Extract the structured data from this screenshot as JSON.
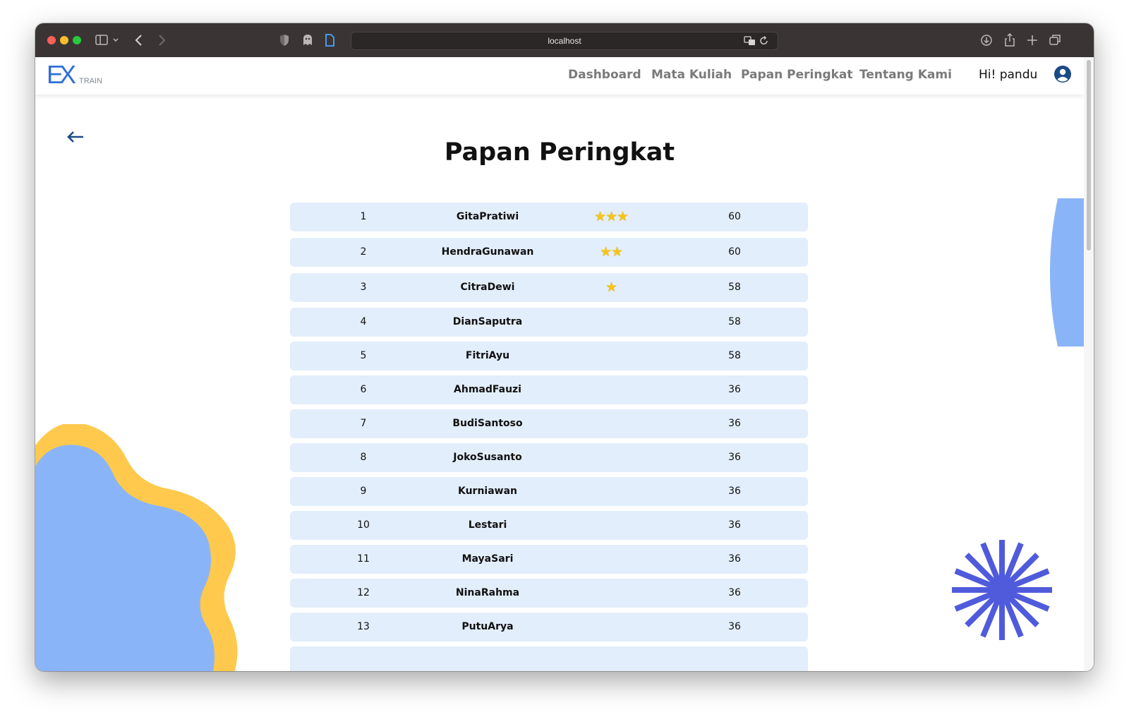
{
  "browser": {
    "url": "localhost"
  },
  "navbar": {
    "logo_main": "EX",
    "logo_sub": "TRAIN",
    "links": [
      {
        "label": "Dashboard"
      },
      {
        "label": "Mata Kuliah"
      },
      {
        "label": "Papan Peringkat"
      },
      {
        "label": "Tentang Kami"
      }
    ],
    "greeting": "Hi! pandu"
  },
  "page": {
    "title": "Papan Peringkat"
  },
  "leaderboard": [
    {
      "rank": "1",
      "name": "GitaPratiwi",
      "stars": "★★★",
      "score": "60"
    },
    {
      "rank": "2",
      "name": "HendraGunawan",
      "stars": "★★",
      "score": "60"
    },
    {
      "rank": "3",
      "name": "CitraDewi",
      "stars": "★",
      "score": "58"
    },
    {
      "rank": "4",
      "name": "DianSaputra",
      "stars": "",
      "score": "58"
    },
    {
      "rank": "5",
      "name": "FitriAyu",
      "stars": "",
      "score": "58"
    },
    {
      "rank": "6",
      "name": "AhmadFauzi",
      "stars": "",
      "score": "36"
    },
    {
      "rank": "7",
      "name": "BudiSantoso",
      "stars": "",
      "score": "36"
    },
    {
      "rank": "8",
      "name": "JokoSusanto",
      "stars": "",
      "score": "36"
    },
    {
      "rank": "9",
      "name": "Kurniawan",
      "stars": "",
      "score": "36"
    },
    {
      "rank": "10",
      "name": "Lestari",
      "stars": "",
      "score": "36"
    },
    {
      "rank": "11",
      "name": "MayaSari",
      "stars": "",
      "score": "36"
    },
    {
      "rank": "12",
      "name": "NinaRahma",
      "stars": "",
      "score": "36"
    },
    {
      "rank": "13",
      "name": "PutuArya",
      "stars": "",
      "score": "36"
    }
  ],
  "colors": {
    "row_bg": "#e3eefc",
    "star": "#f5c518",
    "blob_blue": "#8ab4f8",
    "blob_yellow": "#ffc94d",
    "burst": "#4f5bdb",
    "logo_blue": "#2f6fd6",
    "nav_link": "#7a7a7a"
  },
  "icons": [
    "back-arrow-icon",
    "user-account-icon",
    "sidebar-icon",
    "chevron-left-icon",
    "chevron-right-icon",
    "shield-icon",
    "ghost-icon",
    "page-icon",
    "translate-icon",
    "reload-icon",
    "download-icon",
    "share-icon",
    "plus-icon",
    "tabs-icon"
  ]
}
